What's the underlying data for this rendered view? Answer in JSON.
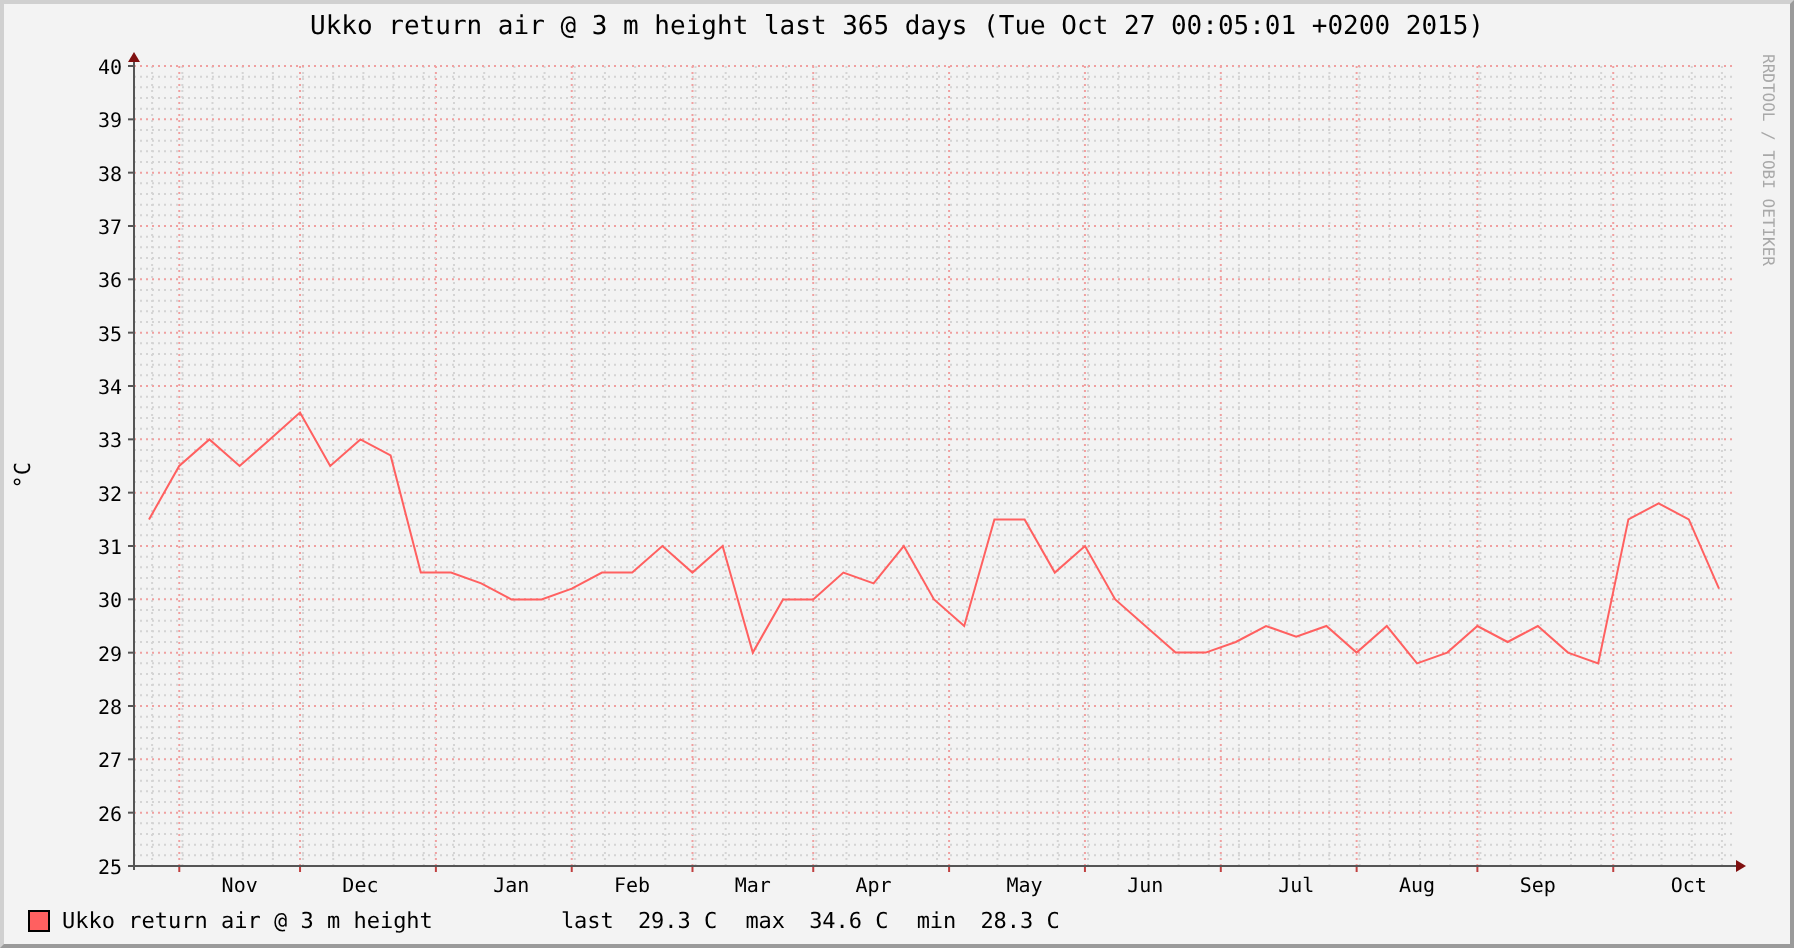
{
  "chart_data": {
    "type": "line",
    "title": "Ukko return air @ 3 m height last 365 days (Tue Oct 27 00:05:01 +0200 2015)",
    "ylabel": "°C",
    "categories": [
      null,
      null,
      null,
      "Nov",
      null,
      null,
      null,
      "Dec",
      null,
      null,
      null,
      null,
      "Jan",
      null,
      null,
      null,
      "Feb",
      null,
      null,
      null,
      "Mar",
      null,
      null,
      null,
      "Apr",
      null,
      null,
      null,
      null,
      "May",
      null,
      null,
      null,
      "Jun",
      null,
      null,
      null,
      null,
      "Jul",
      null,
      null,
      null,
      "Aug",
      null,
      null,
      null,
      "Sep",
      null,
      null,
      null,
      null,
      "Oct",
      null
    ],
    "series": [
      {
        "name": "Ukko return air @ 3 m height",
        "color": "#ff6060",
        "values": [
          31.5,
          32.5,
          33,
          32.5,
          33,
          33.5,
          32.5,
          33,
          32.7,
          30.5,
          30.5,
          30.3,
          30,
          30,
          30.2,
          30.5,
          30.5,
          31,
          30.5,
          31,
          29,
          30,
          30,
          30.5,
          30.3,
          31,
          30,
          29.5,
          31.5,
          31.5,
          30.5,
          31,
          30,
          29.5,
          29,
          29,
          29.2,
          29.5,
          29.3,
          29.5,
          29,
          29.5,
          28.8,
          29,
          29.5,
          29.2,
          29.5,
          29,
          28.8,
          31.5,
          31.8,
          31.5,
          30.2
        ]
      }
    ],
    "grid": true,
    "ylim": [
      25,
      40
    ],
    "yticks": [
      25,
      26,
      27,
      28,
      29,
      30,
      31,
      32,
      33,
      34,
      35,
      36,
      37,
      38,
      39,
      40
    ]
  },
  "legend": {
    "stats": [
      {
        "label": "last",
        "value": "29.3 C"
      },
      {
        "label": "max",
        "value": "34.6 C"
      },
      {
        "label": "min",
        "value": "28.3 C"
      }
    ]
  },
  "credit": "RRDTOOL / TOBI OETIKER"
}
